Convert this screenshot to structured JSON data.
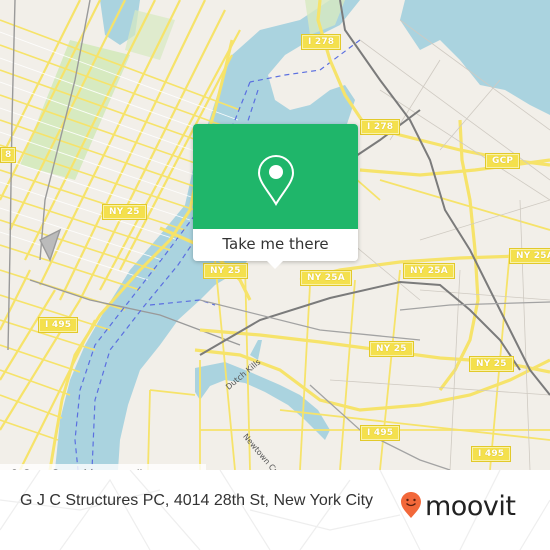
{
  "map": {
    "colors": {
      "land": "#f2efe9",
      "water": "#aad3df",
      "park": "#d7eac0",
      "road_major": "#f6e36a",
      "road_minor": "#ffffff",
      "rail": "#888888",
      "ferry": "#5b6fe0"
    },
    "shields": [
      {
        "label": "I 278"
      },
      {
        "label": "I 278"
      },
      {
        "label": "GCP"
      },
      {
        "label": "8"
      },
      {
        "label": "NY 25"
      },
      {
        "label": "NY 25"
      },
      {
        "label": "NY 25A"
      },
      {
        "label": "NY 25A"
      },
      {
        "label": "NY 25A"
      },
      {
        "label": "I 495"
      },
      {
        "label": "NY 25"
      },
      {
        "label": "NY 25"
      },
      {
        "label": "I 495"
      },
      {
        "label": "I 495"
      }
    ],
    "water_labels": {
      "dutch_kills": "Dutch Kills",
      "newtown_creek": "Newtown Creek"
    },
    "attribution": "© OpenStreetMap contributors"
  },
  "popup": {
    "button_label": "Take me there",
    "icon": "map-pin-icon",
    "accent": "#1fb66a"
  },
  "footer": {
    "place_title": "G J C Structures PC, 4014 28th St, New York City",
    "brand": "moovit",
    "brand_color": "#f2683a"
  }
}
